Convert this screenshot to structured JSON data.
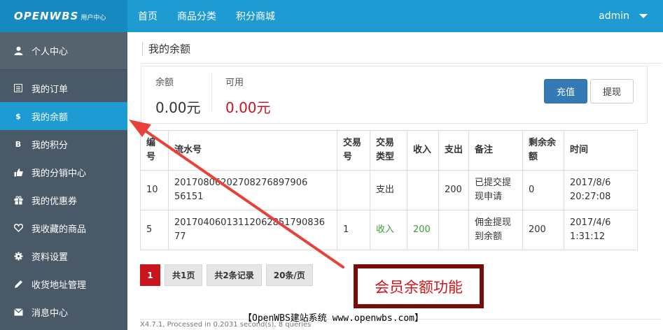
{
  "brand": {
    "logo": "OPENWBS",
    "sub": "用户中心"
  },
  "topnav": [
    "首页",
    "商品分类",
    "积分商城"
  ],
  "user": {
    "name": "admin"
  },
  "sidebar": {
    "header": "个人中心",
    "items": [
      {
        "label": "我的订单",
        "icon": "list-icon"
      },
      {
        "label": "我的余额",
        "icon": "dollar-icon",
        "active": true
      },
      {
        "label": "我的积分",
        "icon": "b-icon"
      },
      {
        "label": "我的分销中心",
        "icon": "thumbs-up-icon"
      },
      {
        "label": "我的优惠券",
        "icon": "gift-icon"
      },
      {
        "label": "我收藏的商品",
        "icon": "heart-icon"
      },
      {
        "label": "资料设置",
        "icon": "gear-icon"
      },
      {
        "label": "收货地址管理",
        "icon": "pencil-icon"
      },
      {
        "label": "消息中心",
        "icon": "envelope-icon"
      }
    ]
  },
  "page": {
    "title": "我的余额",
    "balance_label": "余额",
    "balance_value": "0.00元",
    "available_label": "可用",
    "available_value": "0.00元",
    "recharge_button": "充值",
    "withdraw_button": "提现"
  },
  "table": {
    "headers": [
      "编号",
      "流水号",
      "交易号",
      "交易类型",
      "收入",
      "支出",
      "备注",
      "剩余余额",
      "时间"
    ],
    "rows": [
      [
        "10",
        "20170806202708276897906 56151",
        "",
        "支出",
        "",
        "200",
        "已提交提现申请",
        "0",
        "2017/8/6 20:27:08"
      ],
      [
        "5",
        "20170406013112062851790836 77",
        "1",
        "收入",
        "200",
        "",
        "佣金提现到余额",
        "200",
        "2017/4/6 1:31:12"
      ]
    ]
  },
  "pager": {
    "current": "1",
    "pages": "共1页",
    "records": "共2条记录",
    "per_page": "20条/页"
  },
  "footer": "X4.7.1, Processed in 0.2031 second(s), 8 queries",
  "watermark": "【OpenWBS建站系统 www.openwbs.com】",
  "callout": "会员余额功能",
  "colors": {
    "topbar": "#1e9bd2",
    "sidebar": "#4a5967",
    "accent_red": "#c9151e",
    "arrow": "#e8413c"
  }
}
